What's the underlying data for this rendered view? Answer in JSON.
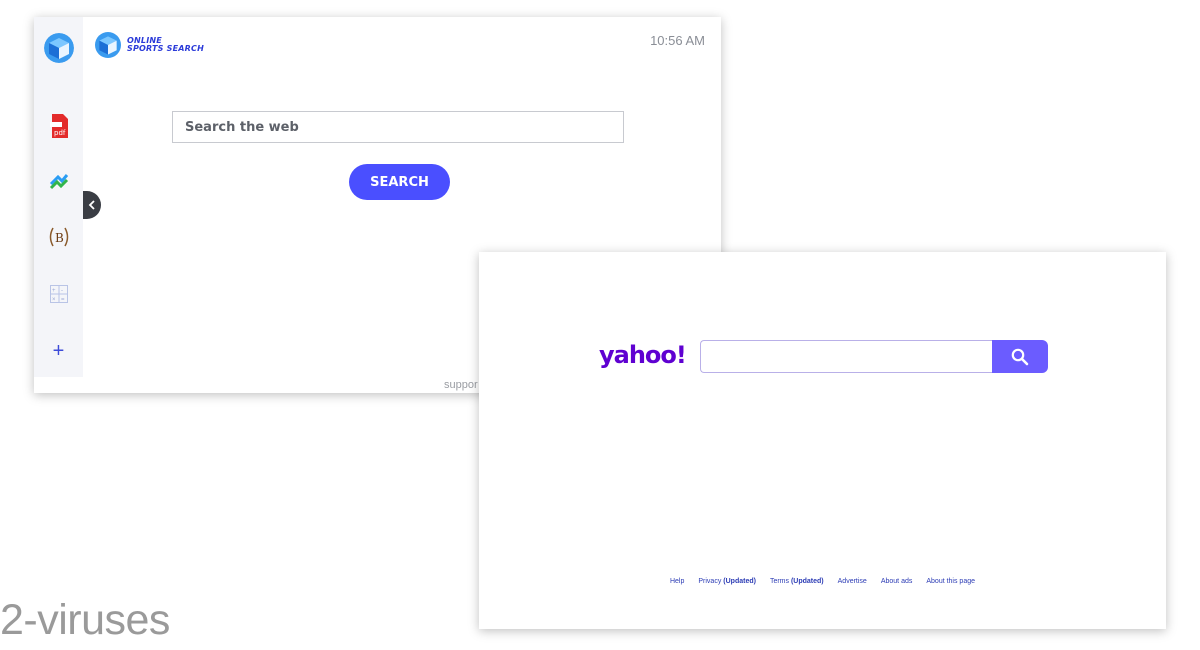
{
  "oss": {
    "brand_line1": "ONLINE",
    "brand_line2": "SPORTS SEARCH",
    "clock": "10:56 AM",
    "search_placeholder": "Search the web",
    "search_button": "SEARCH",
    "footer_partial": "suppor",
    "sidebar": {
      "items": [
        {
          "name": "pdf-icon",
          "label": "pdf"
        },
        {
          "name": "arrows-icon"
        },
        {
          "name": "bitcoin-icon",
          "label": "B"
        },
        {
          "name": "calculator-icon"
        },
        {
          "name": "add-icon",
          "label": "+"
        }
      ]
    },
    "colors": {
      "accent": "#4a4fff",
      "brand": "#2b3bd9"
    }
  },
  "yahoo": {
    "logo": "yahoo!",
    "search_value": "",
    "footer": [
      {
        "label": "Help",
        "bold": ""
      },
      {
        "label": "Privacy",
        "bold": "(Updated)"
      },
      {
        "label": "Terms",
        "bold": "(Updated)"
      },
      {
        "label": "Advertise",
        "bold": ""
      },
      {
        "label": "About ads",
        "bold": ""
      },
      {
        "label": "About this page",
        "bold": ""
      }
    ],
    "colors": {
      "brand": "#5f01d1",
      "button": "#6b5cff"
    }
  },
  "watermark": "2-viruses"
}
